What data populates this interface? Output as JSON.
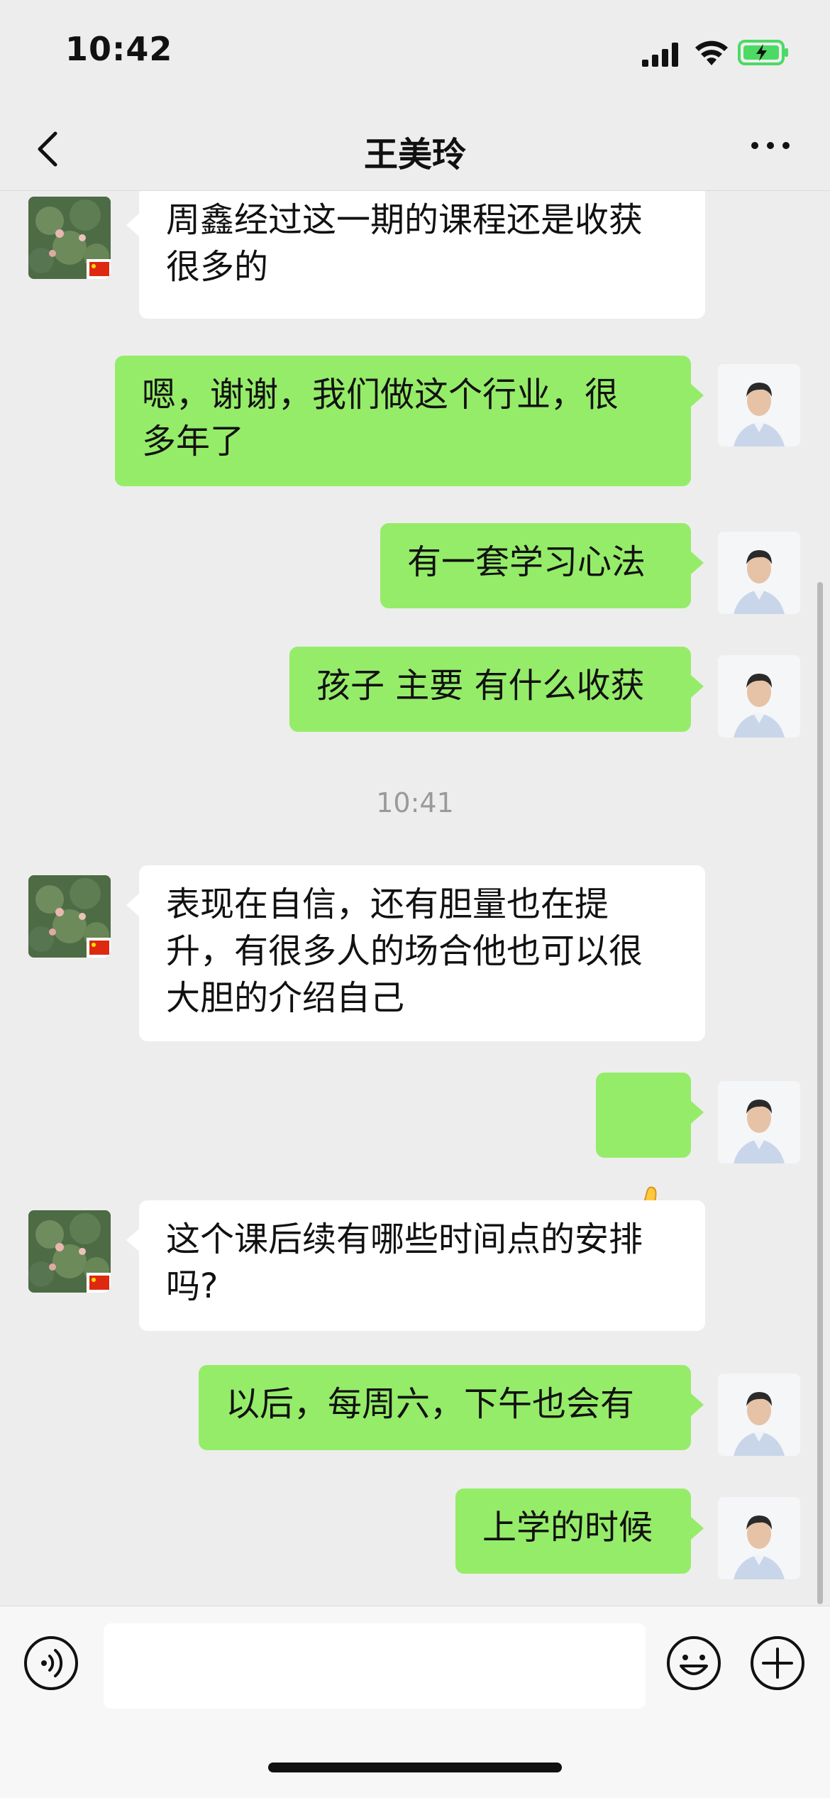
{
  "status": {
    "time": "10:42",
    "battery_color": "#4cd964"
  },
  "nav": {
    "title": "王美玲",
    "back_icon": "chevron-left-icon",
    "more_icon": "more-dots-icon"
  },
  "theme": {
    "chat_background": "#ededed",
    "received_bubble": "#ffffff",
    "sent_bubble": "#95ec69"
  },
  "messages": [
    {
      "side": "left",
      "text": "周鑫经过这一期的课程还是收获\n很多的"
    },
    {
      "side": "right",
      "text": "嗯，谢谢，我们做这个行业，很\n多年了"
    },
    {
      "side": "right",
      "text": "有一套学习心法"
    },
    {
      "side": "right",
      "text": "孩子 主要 有什么收获"
    },
    {
      "type": "time",
      "text": "10:41"
    },
    {
      "side": "left",
      "text": "表现在自信，还有胆量也在提\n升，有很多人的场合他也可以很\n大胆的介绍自己"
    },
    {
      "side": "right",
      "text": "👍",
      "kind": "emoji"
    },
    {
      "side": "left",
      "text": "这个课后续有哪些时间点的安排\n吗?"
    },
    {
      "side": "right",
      "text": "以后，每周六，下午也会有"
    },
    {
      "side": "right",
      "text": "上学的时候"
    }
  ],
  "input_bar": {
    "placeholder": "",
    "voice_icon": "voice-icon",
    "emoji_icon": "emoji-icon",
    "plus_icon": "plus-circle-icon"
  }
}
